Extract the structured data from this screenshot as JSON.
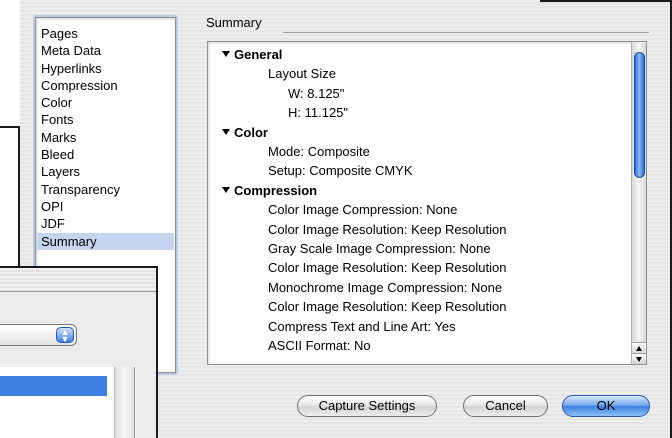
{
  "dialog": {
    "categories": [
      {
        "label": "Pages",
        "selected": false
      },
      {
        "label": "Meta Data",
        "selected": false
      },
      {
        "label": "Hyperlinks",
        "selected": false
      },
      {
        "label": "Compression",
        "selected": false
      },
      {
        "label": "Color",
        "selected": false
      },
      {
        "label": "Fonts",
        "selected": false
      },
      {
        "label": "Marks",
        "selected": false
      },
      {
        "label": "Bleed",
        "selected": false
      },
      {
        "label": "Layers",
        "selected": false
      },
      {
        "label": "Transparency",
        "selected": false
      },
      {
        "label": "OPI",
        "selected": false
      },
      {
        "label": "JDF",
        "selected": false
      },
      {
        "label": "Summary",
        "selected": true
      }
    ],
    "summary_label": "Summary",
    "summary_tree": [
      {
        "text": "General",
        "section": true,
        "indent": 0
      },
      {
        "text": "Layout Size",
        "section": false,
        "indent": 1
      },
      {
        "text": "W: 8.125\"",
        "section": false,
        "indent": 2
      },
      {
        "text": "H: 11.125\"",
        "section": false,
        "indent": 2
      },
      {
        "text": "Color",
        "section": true,
        "indent": 0
      },
      {
        "text": "Mode: Composite",
        "section": false,
        "indent": 1
      },
      {
        "text": "Setup: Composite CMYK",
        "section": false,
        "indent": 1
      },
      {
        "text": "Compression",
        "section": true,
        "indent": 0
      },
      {
        "text": "Color Image Compression: None",
        "section": false,
        "indent": 1
      },
      {
        "text": "Color Image Resolution: Keep Resolution",
        "section": false,
        "indent": 1
      },
      {
        "text": "Gray Scale Image Compression: None",
        "section": false,
        "indent": 1
      },
      {
        "text": "Color Image Resolution: Keep Resolution",
        "section": false,
        "indent": 1
      },
      {
        "text": "Monochrome Image Compression: None",
        "section": false,
        "indent": 1
      },
      {
        "text": "Color Image Resolution: Keep Resolution",
        "section": false,
        "indent": 1
      },
      {
        "text": "Compress Text and Line Art: Yes",
        "section": false,
        "indent": 1
      },
      {
        "text": "ASCII Format: No",
        "section": false,
        "indent": 1
      }
    ],
    "buttons": {
      "capture": "Capture Settings",
      "cancel": "Cancel",
      "ok": "OK"
    },
    "icons": {
      "disclosure": "disclosure-triangle-down-icon",
      "popup_arrows": "up-down-arrows-icon"
    },
    "colors": {
      "selection": "#c5d5ef",
      "accent": "#3f7fe1"
    }
  }
}
